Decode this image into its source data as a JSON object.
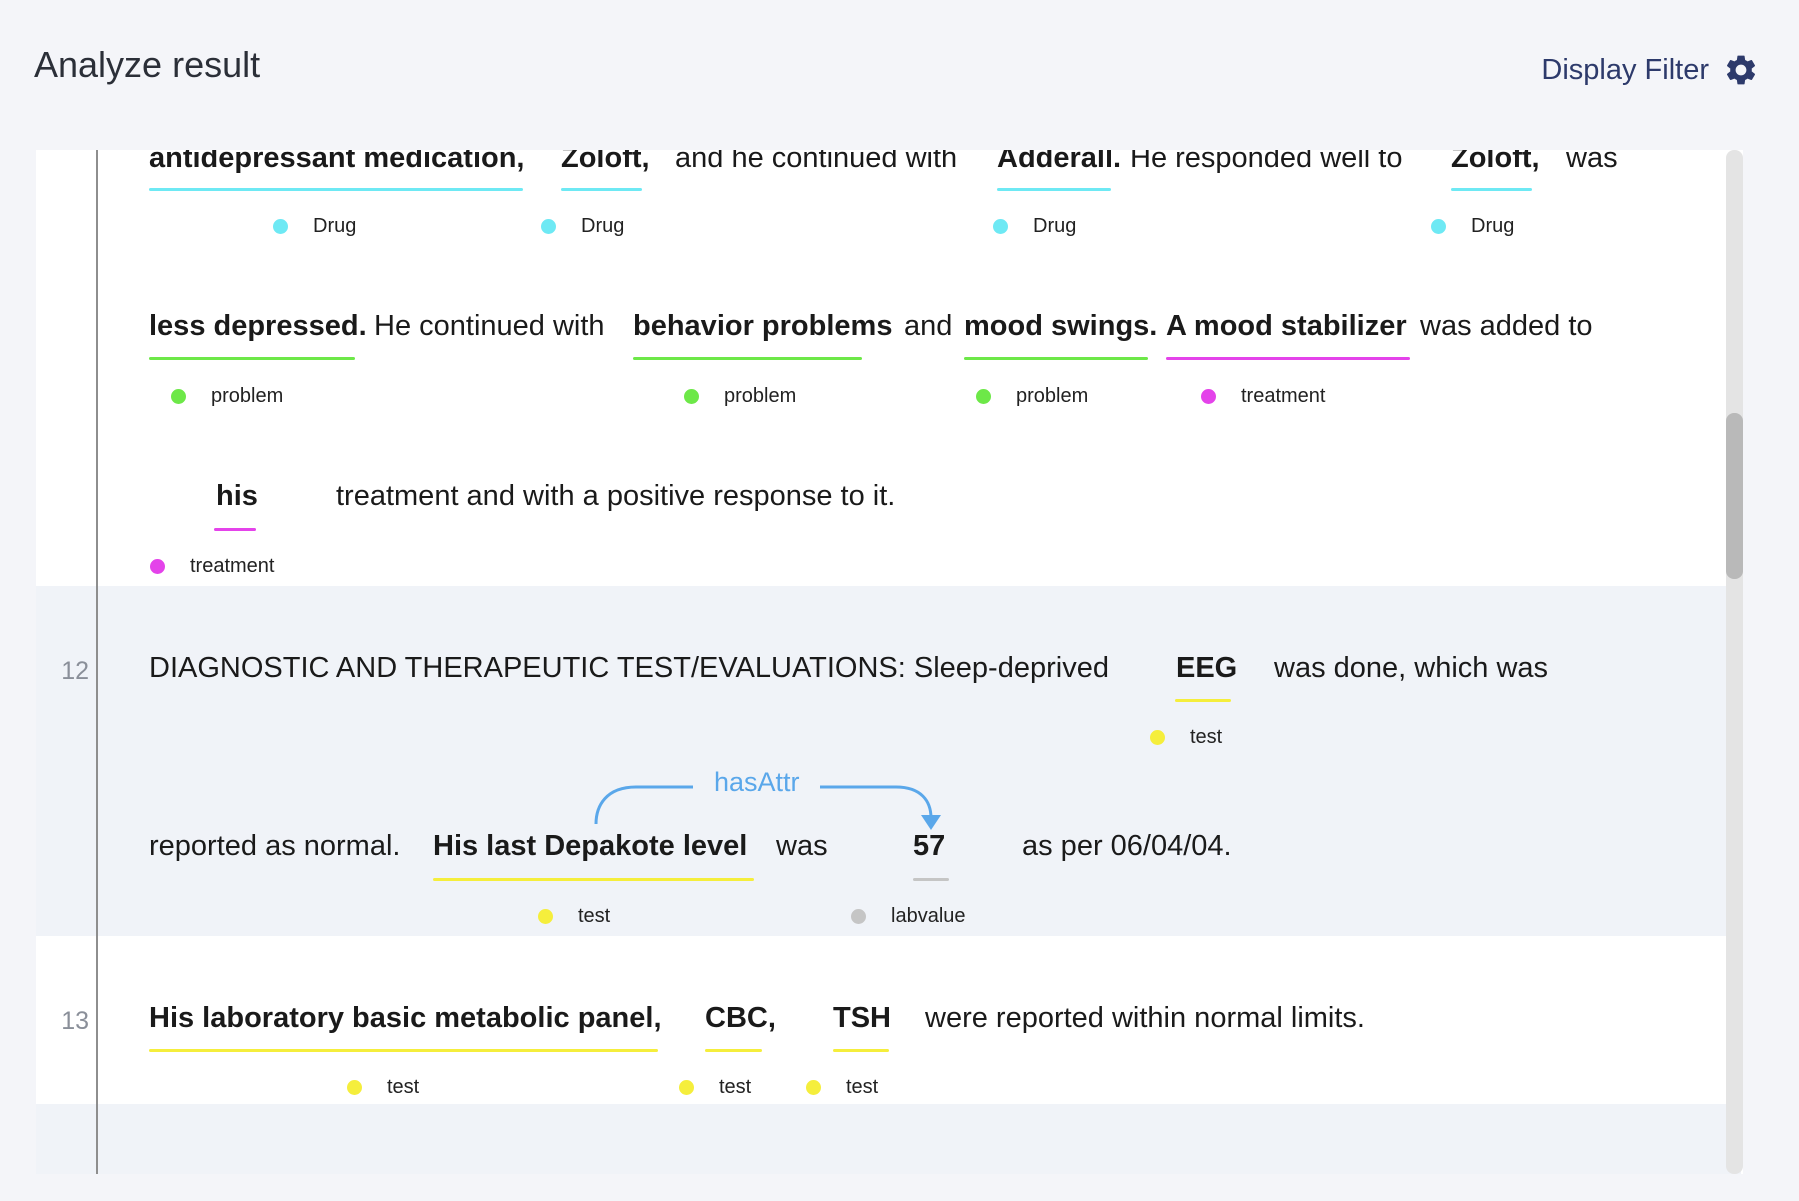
{
  "header": {
    "title": "Analyze result",
    "filter_label": "Display Filter",
    "filter_icon": "gear-icon"
  },
  "colors": {
    "drug": "#6ee9f4",
    "problem": "#6de848",
    "treatment": "#e443ea",
    "test": "#f5ee3c",
    "labvalue": "#c5c5c5",
    "relation": "#5aa7ea"
  },
  "line11": {
    "words": [
      "antidepressant medication,",
      "Zoloft,",
      "and he continued with",
      "Adderall.",
      "He responded well to",
      "Zoloft,",
      "was",
      "less depressed.",
      "He continued with",
      "behavior problems",
      "and",
      "mood swings.",
      "A mood stabilizer",
      "was added to",
      "his",
      "treatment and with a positive response to it."
    ],
    "tags": [
      "Drug",
      "Drug",
      "Drug",
      "Drug",
      "problem",
      "problem",
      "problem",
      "treatment",
      "treatment"
    ]
  },
  "line12": {
    "number": "12",
    "words": [
      "DIAGNOSTIC AND THERAPEUTIC TEST/EVALUATIONS: Sleep-deprived",
      "EEG",
      "was done, which was",
      "reported as normal.",
      "His last Depakote level",
      "was",
      "57",
      "as per 06/04/04."
    ],
    "tags": [
      "test",
      "test",
      "labvalue"
    ],
    "relation": "hasAttr"
  },
  "line13": {
    "number": "13",
    "words": [
      "His laboratory basic metabolic panel,",
      "CBC,",
      "TSH",
      "were reported within normal limits."
    ],
    "tags": [
      "test",
      "test",
      "test"
    ]
  }
}
